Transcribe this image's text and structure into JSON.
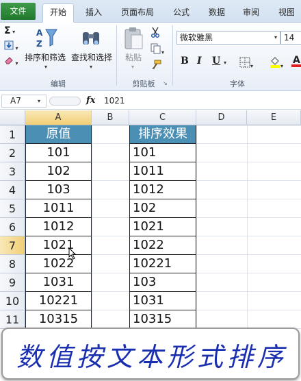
{
  "tabs": [
    "文件",
    "开始",
    "插入",
    "页面布局",
    "公式",
    "数据",
    "审阅",
    "视图"
  ],
  "ribbon": {
    "sort_filter_label": "排序和筛选",
    "find_select_label": "查找和选择",
    "paste_label": "粘贴",
    "font_name": "微软雅黑",
    "font_size": "14",
    "bold": "B",
    "italic": "I",
    "underline": "U",
    "groups": {
      "edit": "编辑",
      "clipboard": "剪贴板",
      "font": "字体"
    }
  },
  "formula_bar": {
    "name_box": "A7",
    "fx": "fx",
    "value": "1021"
  },
  "columns": [
    "A",
    "B",
    "C",
    "D",
    "E"
  ],
  "rows": [
    "1",
    "2",
    "3",
    "4",
    "5",
    "6",
    "7",
    "8",
    "9",
    "10",
    "11"
  ],
  "table": {
    "header_a": "原值",
    "header_c": "排序效果",
    "col_a": [
      "101",
      "102",
      "103",
      "1011",
      "1012",
      "1021",
      "1022",
      "1031",
      "10221",
      "10315"
    ],
    "col_c": [
      "101",
      "1011",
      "1012",
      "102",
      "1021",
      "1022",
      "10221",
      "103",
      "1031",
      "10315"
    ]
  },
  "banner": "数值按文本形式排序",
  "colors": {
    "header_fill": "#4b8fb5",
    "file_tab": "#217a2c",
    "banner_text": "#1a2fb0"
  }
}
